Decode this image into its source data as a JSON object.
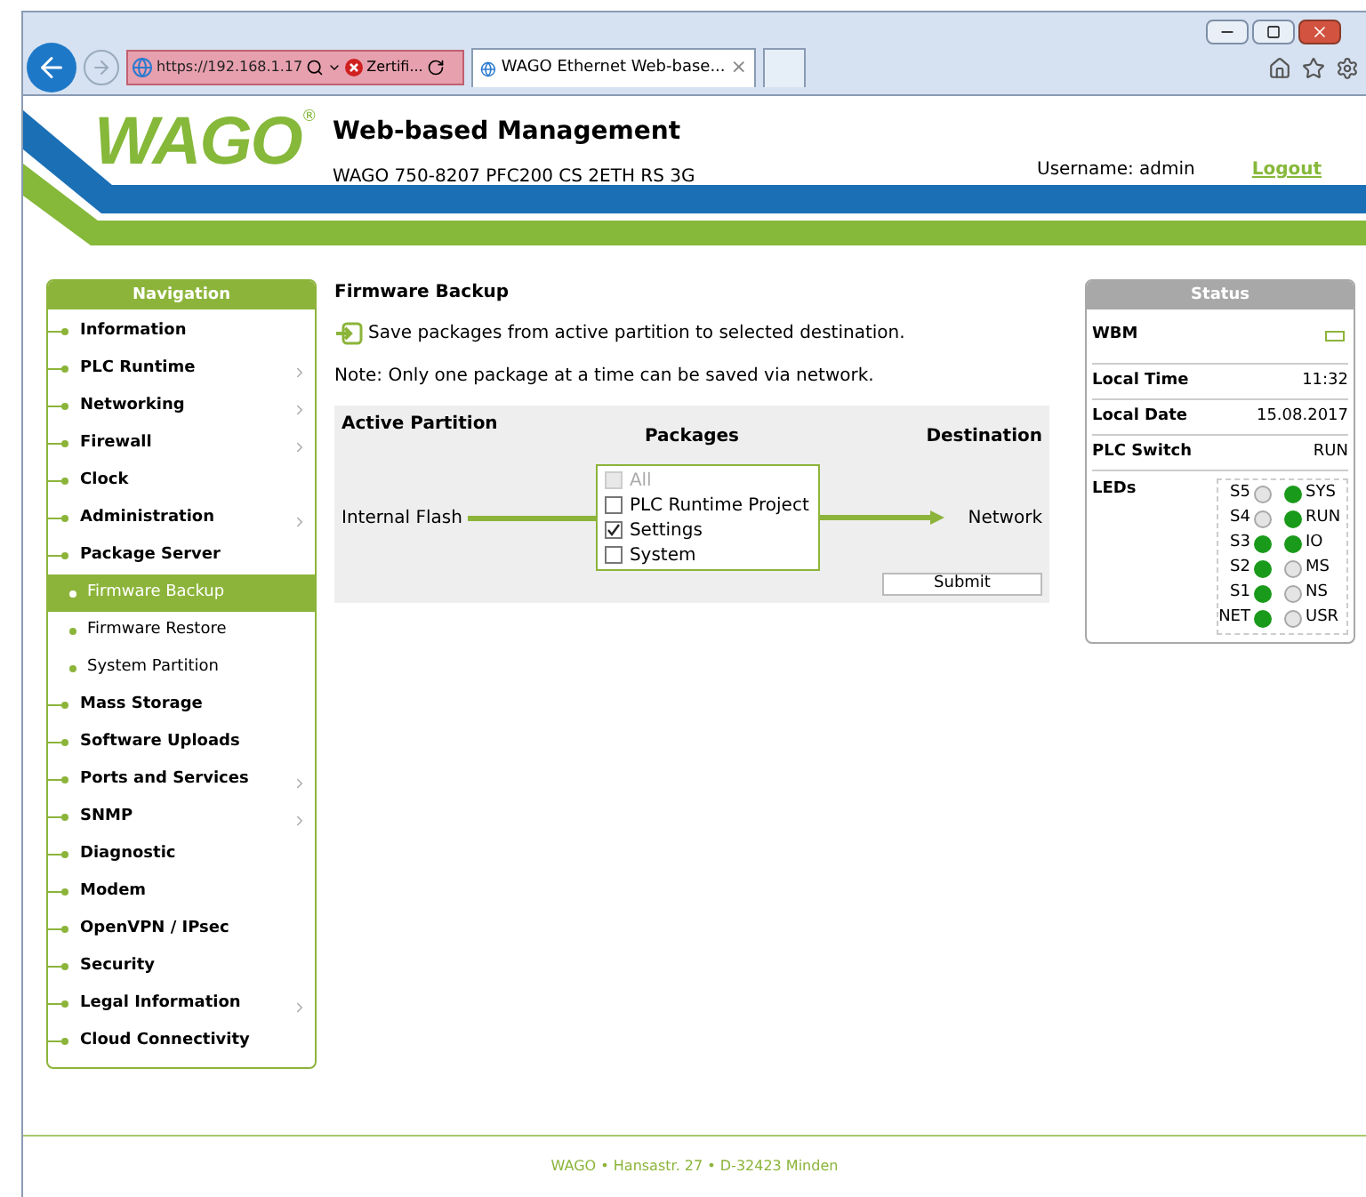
{
  "browser": {
    "address": "https://192.168.1.17",
    "certificate": "Zertifi...",
    "tabs": [
      {
        "label": "WAGO Ethernet Web-base...",
        "close": "×",
        "selected": true
      }
    ]
  },
  "header": {
    "logo": "WAGO",
    "registered": "®",
    "title": "Web-based Management",
    "device": "WAGO 750-8207 PFC200 CS 2ETH RS 3G",
    "username": "Username: admin",
    "logout": "Logout"
  },
  "navigation": {
    "title": "Navigation",
    "items": [
      {
        "label": "Information",
        "kind": "top",
        "submenu": false,
        "selected": false
      },
      {
        "label": "PLC Runtime",
        "kind": "top",
        "submenu": true,
        "selected": false
      },
      {
        "label": "Networking",
        "kind": "top",
        "submenu": true,
        "selected": false
      },
      {
        "label": "Firewall",
        "kind": "top",
        "submenu": true,
        "selected": false
      },
      {
        "label": "Clock",
        "kind": "top",
        "submenu": false,
        "selected": false
      },
      {
        "label": "Administration",
        "kind": "top",
        "submenu": true,
        "selected": false
      },
      {
        "label": "Package Server",
        "kind": "top",
        "submenu": false,
        "selected": false
      },
      {
        "label": "Firmware Backup",
        "kind": "sub",
        "submenu": false,
        "selected": true
      },
      {
        "label": "Firmware Restore",
        "kind": "sub",
        "submenu": false,
        "selected": false
      },
      {
        "label": "System Partition",
        "kind": "sub",
        "submenu": false,
        "selected": false
      },
      {
        "label": "Mass Storage",
        "kind": "top",
        "submenu": false,
        "selected": false
      },
      {
        "label": "Software Uploads",
        "kind": "top",
        "submenu": false,
        "selected": false
      },
      {
        "label": "Ports and Services",
        "kind": "top",
        "submenu": true,
        "selected": false
      },
      {
        "label": "SNMP",
        "kind": "top",
        "submenu": true,
        "selected": false
      },
      {
        "label": "Diagnostic",
        "kind": "top",
        "submenu": false,
        "selected": false
      },
      {
        "label": "Modem",
        "kind": "top",
        "submenu": false,
        "selected": false
      },
      {
        "label": "OpenVPN / IPsec",
        "kind": "top",
        "submenu": false,
        "selected": false
      },
      {
        "label": "Security",
        "kind": "top",
        "submenu": false,
        "selected": false
      },
      {
        "label": "Legal Information",
        "kind": "top",
        "submenu": true,
        "selected": false
      },
      {
        "label": "Cloud Connectivity",
        "kind": "top",
        "submenu": false,
        "selected": false
      }
    ]
  },
  "content": {
    "title": "Firmware Backup",
    "info": "Save packages from active partition to selected destination.",
    "note": "Note: Only one package at a time can be saved via network.",
    "columns": [
      "Active Partition",
      "Packages",
      "Destination"
    ],
    "source": "Internal Flash",
    "destination": "Network",
    "packages": [
      {
        "label": "All",
        "checked": false,
        "disabled": true
      },
      {
        "label": "PLC Runtime Project",
        "checked": false,
        "disabled": false
      },
      {
        "label": "Settings",
        "checked": true,
        "disabled": false
      },
      {
        "label": "System",
        "checked": false,
        "disabled": false
      }
    ],
    "submit": "Submit"
  },
  "status": {
    "title": "Status",
    "rows": [
      {
        "label": "WBM",
        "kind": "indicator"
      },
      {
        "label": "Local Time",
        "kind": "text",
        "value": "11:32"
      },
      {
        "label": "Local Date",
        "kind": "text",
        "value": "15.08.2017"
      },
      {
        "label": "PLC Switch",
        "kind": "text",
        "value": "RUN"
      }
    ],
    "leds_label": "LEDs",
    "leds": [
      [
        {
          "label": "S5",
          "on": false
        },
        {
          "label": "SYS",
          "on": true
        }
      ],
      [
        {
          "label": "S4",
          "on": false
        },
        {
          "label": "RUN",
          "on": true
        }
      ],
      [
        {
          "label": "S3",
          "on": true
        },
        {
          "label": "IO",
          "on": true
        }
      ],
      [
        {
          "label": "S2",
          "on": true
        },
        {
          "label": "MS",
          "on": false
        }
      ],
      [
        {
          "label": "S1",
          "on": true
        },
        {
          "label": "NS",
          "on": false
        }
      ],
      [
        {
          "label": "NET",
          "on": true
        },
        {
          "label": "USR",
          "on": false
        }
      ]
    ]
  },
  "footer": "WAGO • Hansastr. 27 • D-32423 Minden"
}
